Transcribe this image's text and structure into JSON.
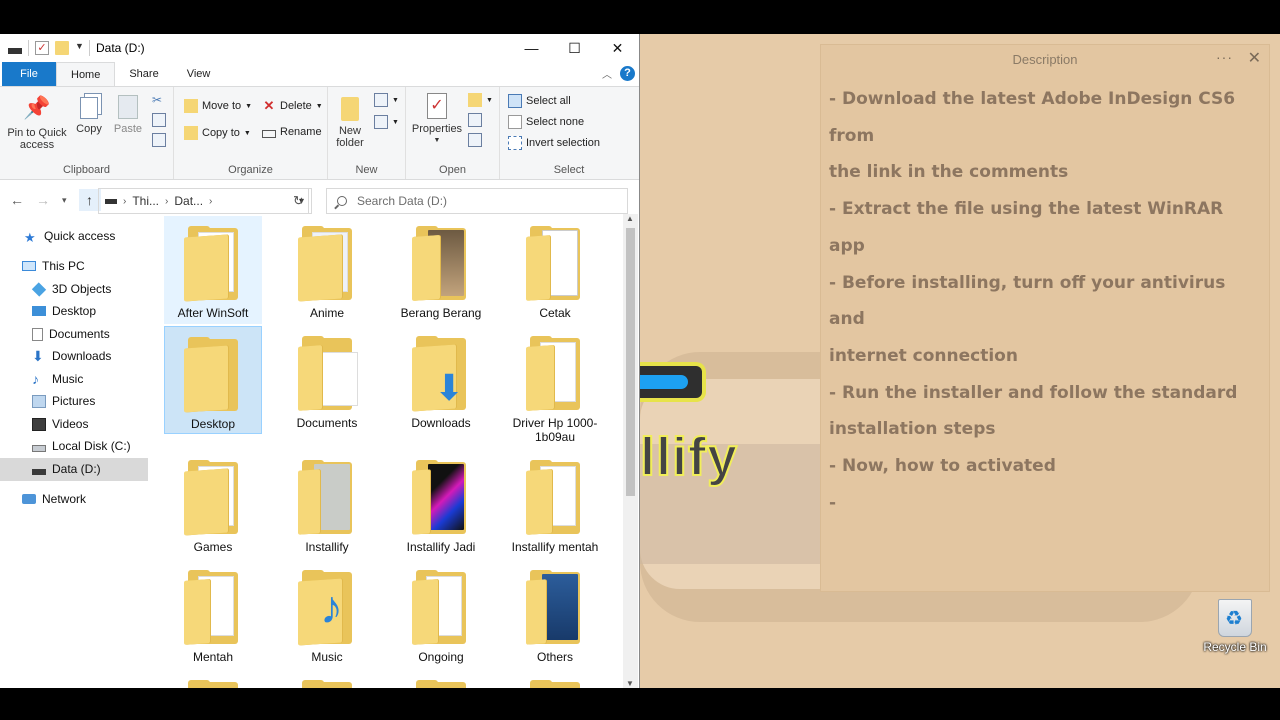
{
  "window": {
    "title": "Data (D:)",
    "controls": {
      "minimize": "—",
      "maximize": "☐",
      "close": "✕"
    }
  },
  "ribbon_tabs": [
    "File",
    "Home",
    "Share",
    "View"
  ],
  "ribbon": {
    "clipboard": {
      "group_label": "Clipboard",
      "pin_label_1": "Pin to Quick",
      "pin_label_2": "access",
      "copy": "Copy",
      "paste": "Paste"
    },
    "organize": {
      "group_label": "Organize",
      "move_to": "Move to",
      "copy_to": "Copy to",
      "delete": "Delete",
      "rename": "Rename"
    },
    "new": {
      "group_label": "New",
      "new_folder_1": "New",
      "new_folder_2": "folder"
    },
    "open": {
      "group_label": "Open",
      "properties": "Properties"
    },
    "select": {
      "group_label": "Select",
      "select_all": "Select all",
      "select_none": "Select none",
      "invert_selection": "Invert selection"
    }
  },
  "address": {
    "crumbs": [
      "Thi...",
      "Dat..."
    ],
    "search_placeholder": "Search Data (D:)"
  },
  "nav_pane": [
    {
      "label": "Quick access",
      "icon": "star-icon"
    },
    {
      "label": "This PC",
      "icon": "computer-icon"
    },
    {
      "label": "3D Objects",
      "icon": "cube-icon"
    },
    {
      "label": "Desktop",
      "icon": "desktop-icon"
    },
    {
      "label": "Documents",
      "icon": "document-icon"
    },
    {
      "label": "Downloads",
      "icon": "download-icon"
    },
    {
      "label": "Music",
      "icon": "music-icon"
    },
    {
      "label": "Pictures",
      "icon": "pictures-icon"
    },
    {
      "label": "Videos",
      "icon": "video-icon"
    },
    {
      "label": "Local Disk (C:)",
      "icon": "disk-icon"
    },
    {
      "label": "Data (D:)",
      "icon": "drive-icon"
    },
    {
      "label": "Network",
      "icon": "network-icon"
    }
  ],
  "files": [
    {
      "label": "After WinSoft"
    },
    {
      "label": "Anime"
    },
    {
      "label": "Berang Berang"
    },
    {
      "label": "Cetak"
    },
    {
      "label": "Desktop"
    },
    {
      "label": "Documents"
    },
    {
      "label": "Downloads"
    },
    {
      "label": "Driver Hp 1000-1b09au"
    },
    {
      "label": "Games"
    },
    {
      "label": "Installify"
    },
    {
      "label": "Installify Jadi"
    },
    {
      "label": "Installify mentah"
    },
    {
      "label": "Mentah"
    },
    {
      "label": "Music"
    },
    {
      "label": "Ongoing"
    },
    {
      "label": "Others"
    }
  ],
  "description_panel": {
    "title": "Description",
    "menu": "···",
    "close": "✕",
    "lines": [
      "- Download the latest Adobe InDesign CS6 from",
      "the link in the comments",
      "- Extract the file using the latest WinRAR app",
      "- Before installing, turn off your antivirus and",
      "internet connection",
      "- Run the installer and follow the standard",
      "installation steps",
      "- Now, how to activated",
      "-"
    ]
  },
  "background_text": "llify",
  "recycle_bin": {
    "label": "Recycle Bin"
  },
  "colors": {
    "accent": "#1979ca",
    "folder": "#f6d879",
    "selection": "#cce4f7",
    "desktop_bg": "#e6cba8",
    "description_text": "#8d7660"
  }
}
